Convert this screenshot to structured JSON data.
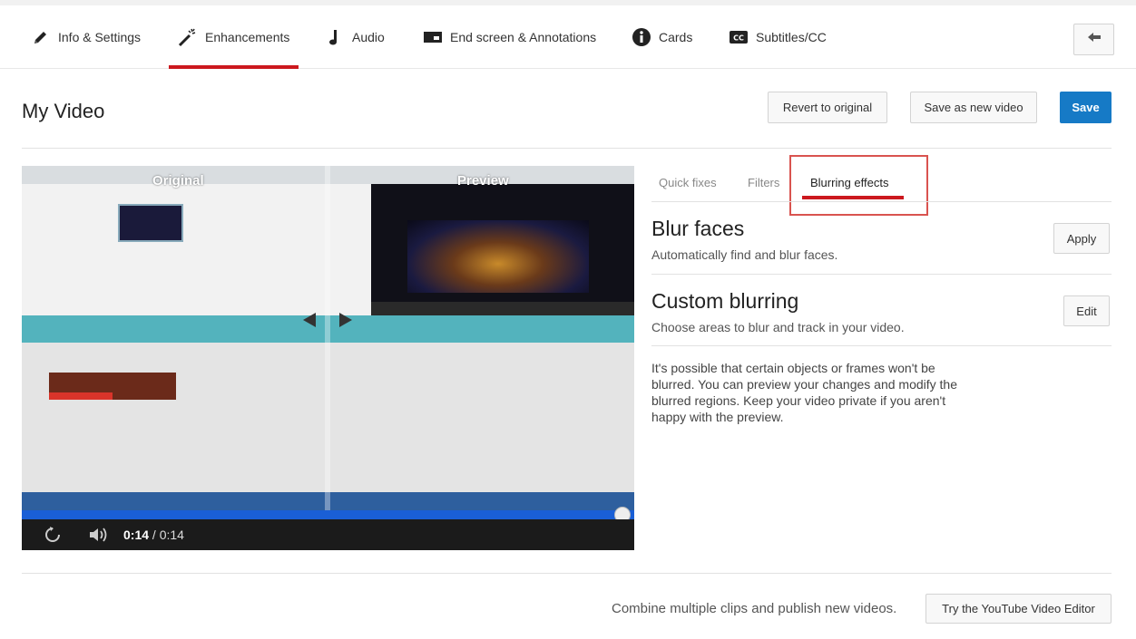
{
  "tabs": [
    {
      "label": "Info & Settings",
      "icon": "pencil-icon"
    },
    {
      "label": "Enhancements",
      "icon": "magic-wand-icon",
      "active": true
    },
    {
      "label": "Audio",
      "icon": "music-note-icon"
    },
    {
      "label": "End screen & Annotations",
      "icon": "end-screen-icon"
    },
    {
      "label": "Cards",
      "icon": "info-icon"
    },
    {
      "label": "Subtitles/CC",
      "icon": "cc-icon"
    }
  ],
  "page_title": "My Video",
  "actions": {
    "revert": "Revert to original",
    "save_new": "Save as new video",
    "save": "Save"
  },
  "video": {
    "original_label": "Original",
    "preview_label": "Preview",
    "time_current": "0:14",
    "time_separator": " / ",
    "time_total": "0:14",
    "progress": 1.0
  },
  "subtabs": [
    {
      "label": "Quick fixes"
    },
    {
      "label": "Filters"
    },
    {
      "label": "Blurring effects",
      "active": true
    }
  ],
  "blur_faces": {
    "title": "Blur faces",
    "description": "Automatically find and blur faces.",
    "button": "Apply"
  },
  "custom_blurring": {
    "title": "Custom blurring",
    "description": "Choose areas to blur and track in your video.",
    "button": "Edit"
  },
  "note": "It's possible that certain objects or frames won't be blurred. You can preview your changes and modify the blurred regions. Keep your video private if you aren't happy with the preview.",
  "footer": {
    "text": "Combine multiple clips and publish new videos.",
    "button": "Try the YouTube Video Editor"
  },
  "colors": {
    "accent_red": "#cc181e",
    "save_blue": "#167ac6",
    "highlight_box": "#d9534f"
  }
}
